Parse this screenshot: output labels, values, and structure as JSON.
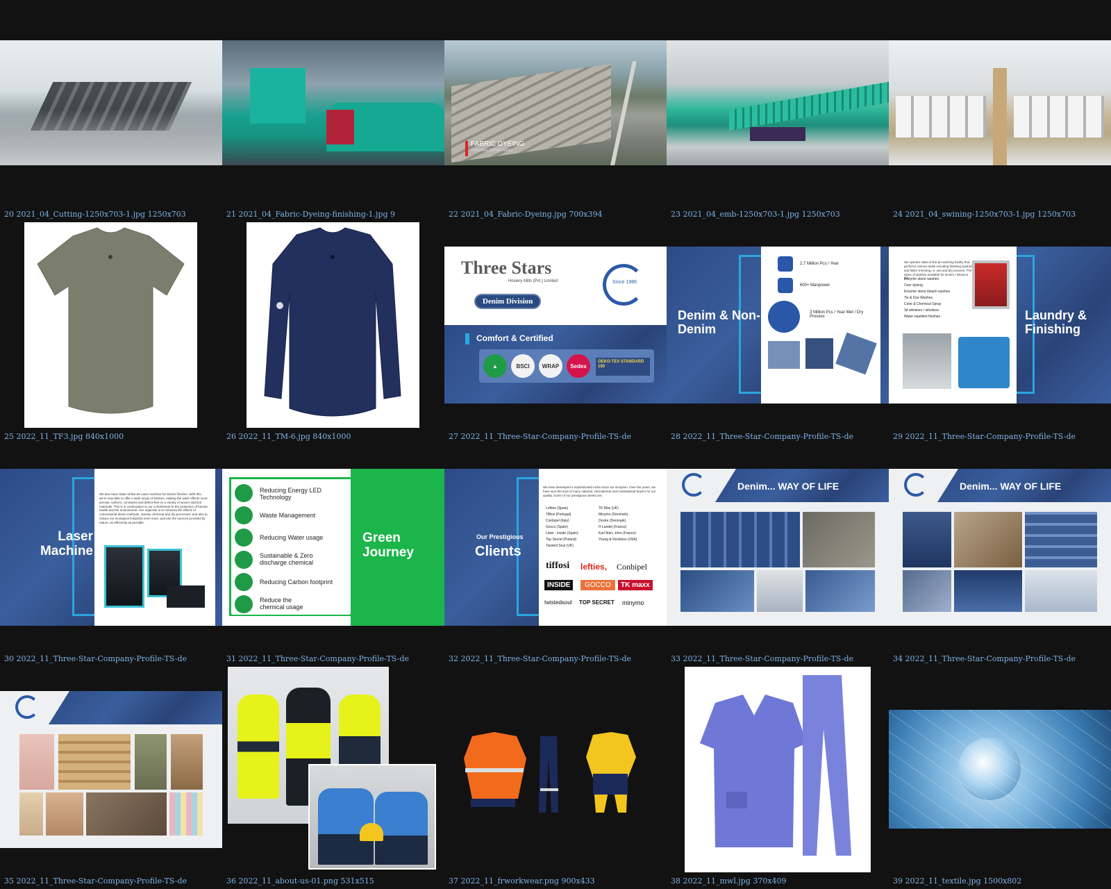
{
  "captions": [
    "20 2021_04_Cutting-1250x703-1.jpg 1250x703",
    "21 2021_04_Fabric-Dyeing-finishing-1.jpg 9",
    "22 2021_04_Fabric-Dyeing.jpg 700x394",
    "23 2021_04_emb-1250x703-1.jpg 1250x703",
    "24 2021_04_swining-1250x703-1.jpg 1250x703",
    "25 2022_11_TF3.jpg 840x1000",
    "26 2022_11_TM-6.jpg 840x1000",
    "27 2022_11_Three-Star-Company-Profile-TS-de",
    "28 2022_11_Three-Star-Company-Profile-TS-de",
    "29 2022_11_Three-Star-Company-Profile-TS-de",
    "30 2022_11_Three-Star-Company-Profile-TS-de",
    "31 2022_11_Three-Star-Company-Profile-TS-de",
    "32 2022_11_Three-Star-Company-Profile-TS-de",
    "33 2022_11_Three-Star-Company-Profile-TS-de",
    "34 2022_11_Three-Star-Company-Profile-TS-de",
    "35 2022_11_Three-Star-Company-Profile-TS-de",
    "36 2022_11_about-us-01.png 531x515",
    "37 2022_11_frworkwear.png 900x433",
    "38 2022_11_mwl.jpg 370x409",
    "39 2022_11_textile.jpg 1500x802"
  ],
  "slides": {
    "s22_overlay": "FABRIC DYEING",
    "s22_sub": "FINISHING DEPARTMENT",
    "s27": {
      "brand": "Three Stars",
      "company": "Hosiery Mills (Pvt.) Limited",
      "division": "Denim Division",
      "since": "Since 1986",
      "comfort": "Comfort & Certified",
      "certs": [
        "BSCI",
        "WRAP",
        "Sedex",
        "OEKO-TEX STANDARD 100"
      ]
    },
    "s28": {
      "title": "Denim & Non-Denim",
      "stat1": "2.7 Million Pcs / Year",
      "stat2": "600+ Manpower",
      "stat3": "3 Million Pcs / Year Wet / Dry Process"
    },
    "s29": {
      "title": "Laundry & Finishing",
      "intro": "We operate state-of-the-art washing facility that performs various tasks including finishing washes and fabric trimming i.e. wet and dry process. The types of washes available for Denim / Wovens are:",
      "items": [
        "Enzyme stone washes",
        "Over dyeing",
        "Enzyme stone bleach washes",
        "Tie & Dye Washes",
        "Color & Chemical Spray",
        "3d whiskers / whiskers",
        "Water repellent finishes"
      ]
    },
    "s30": {
      "title": "Laser Machine",
      "text": "We also have State-of-the-art Laser machine for Denim finishes. With this, we're now able to offer a wide range of finishes, making the wash effects more precise, uniform, consistent and defect-free on a variety of woven and knit materials. This is in continuation to our commitment to the protection of human health and the environment. Our objective is to minimize the effects of conventional denim methods, namely chemical and dry processes, and also to reduce our ecological footprints even more, and use the sources provided by nature, as efficiently as possible."
    },
    "s31": {
      "title": "Green Journey",
      "items": [
        "Reducing Energy LED Technology",
        "Waste Management",
        "Reducing Water usage",
        "Sustainable & Zero discharge chemical",
        "Reducing Carbon footprint",
        "Reduce the chemical usage"
      ]
    },
    "s32": {
      "title_small": "Our Prestigious",
      "title": "Clients",
      "intro": "We have developed a sophisticated niche since our inception. Over the years, we have won the trust of many national, international and multinational buyers for our quality. Some of our prestigious clients are:",
      "left": [
        "Lefties (Spain)",
        "Tiffosi (Portugal)",
        "Conbipel (Italy)",
        "Gocco (Spain)",
        "Liwei - Inside (Spain)",
        "Top Secret (Poland)",
        "Twisted Soul (UK)"
      ],
      "right": [
        "TK Max (UK)",
        "Minymo (Denmark)",
        "Desire (Denmark)",
        "H Landel (France)",
        "Karl Marc John (France)",
        "Young & Reckless (USA)"
      ],
      "logos": [
        "tiffosi",
        "lefties,",
        "Conbipel",
        "INSIDE",
        "GOCCO",
        "TK maxx",
        "twistedsoul",
        "TOP SECRET",
        "minymo"
      ]
    },
    "s33": {
      "title": "Denim... WAY OF LIFE"
    },
    "s34": {
      "title": "Denim... WAY OF LIFE"
    }
  },
  "colors": {
    "background": "#121212",
    "caption": "#7fb2e5",
    "denim": "#2c4b86",
    "accent_blue": "#2aa6e0",
    "green": "#1bb54a"
  }
}
